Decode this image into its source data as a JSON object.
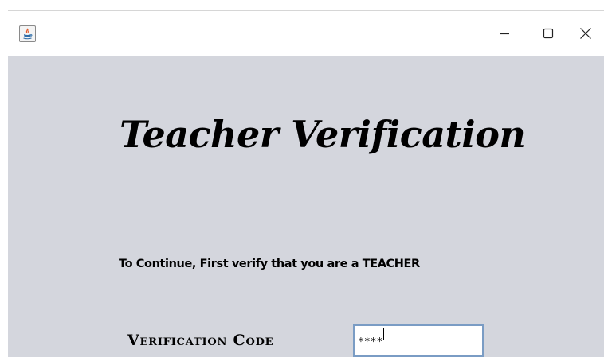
{
  "window": {
    "app_icon": "java-icon",
    "controls": {
      "minimize_icon": "minimize-icon",
      "maximize_icon": "maximize-icon",
      "close_icon": "close-icon"
    }
  },
  "main": {
    "heading": "Teacher Verification",
    "instructions": "To Continue, First verify that you are a TEACHER",
    "verification_label": "Verification Code",
    "verification_value": "****"
  }
}
